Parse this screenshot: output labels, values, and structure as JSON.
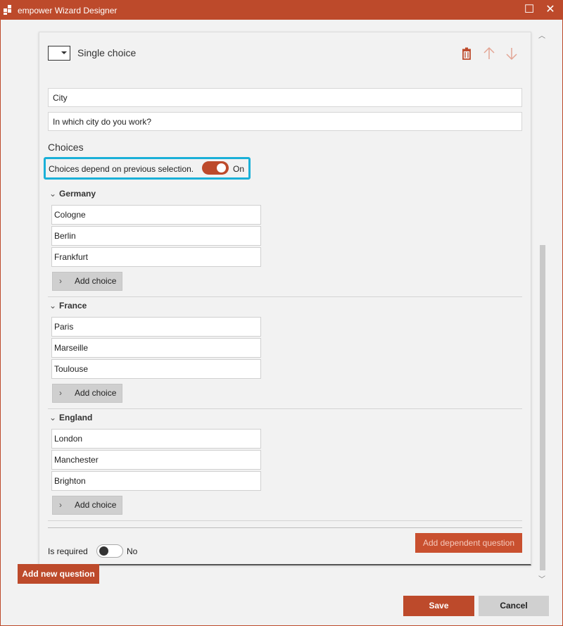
{
  "window": {
    "title": "empower Wizard Designer",
    "maximize_glyph": "☐",
    "close_glyph": "✕"
  },
  "question": {
    "type_label": "Single choice",
    "name_value": "City",
    "text_value": "In which city do you work?",
    "choices_heading": "Choices",
    "depend_label": "Choices depend on previous selection.",
    "depend_state": "On",
    "groups": [
      {
        "name": "Germany",
        "choices": [
          "Cologne",
          "Berlin",
          "Frankfurt"
        ],
        "add_label": "Add choice"
      },
      {
        "name": "France",
        "choices": [
          "Paris",
          "Marseille",
          "Toulouse"
        ],
        "add_label": "Add choice"
      },
      {
        "name": "England",
        "choices": [
          "London",
          "Manchester",
          "Brighton"
        ],
        "add_label": "Add choice"
      }
    ],
    "required_label": "Is required",
    "required_state": "No",
    "add_dependent_label": "Add dependent question"
  },
  "actions": {
    "add_new_question": "Add new question",
    "save": "Save",
    "cancel": "Cancel"
  },
  "colors": {
    "accent": "#bd4a2b",
    "highlight": "#1ab0d8"
  },
  "icons": {
    "delete": "trash-icon",
    "move_up": "arrow-up-icon",
    "move_down": "arrow-down-icon"
  }
}
